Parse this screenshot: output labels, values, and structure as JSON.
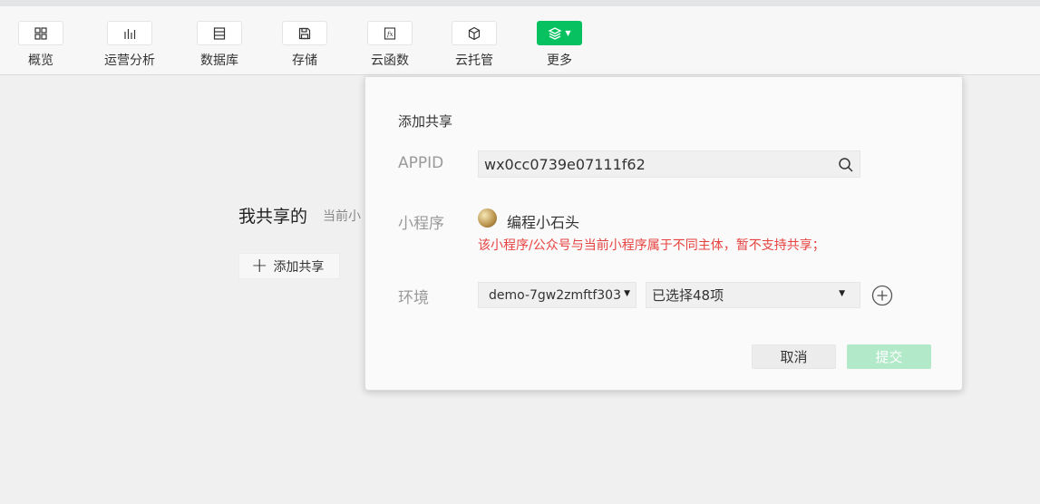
{
  "toolbar": {
    "items": [
      {
        "label": "概览",
        "icon": "grid-icon"
      },
      {
        "label": "运营分析",
        "icon": "bar-chart-icon"
      },
      {
        "label": "数据库",
        "icon": "database-icon"
      },
      {
        "label": "存储",
        "icon": "save-icon"
      },
      {
        "label": "云函数",
        "icon": "function-icon"
      },
      {
        "label": "云托管",
        "icon": "cube-icon"
      },
      {
        "label": "更多",
        "icon": "layers-icon"
      }
    ],
    "accent": "#07c160"
  },
  "background": {
    "title": "我共享的",
    "subtitle": "当前小",
    "add_button": "添加共享"
  },
  "dialog": {
    "title": "添加共享",
    "appid_label": "APPID",
    "appid_value": "wx0cc0739e07111f62",
    "mp_label": "小程序",
    "mp_name": "编程小石头",
    "mp_error": "该小程序/公众号与当前小程序属于不同主体，暂不支持共享；",
    "env_label": "环境",
    "env_value": "demo-7gw2zmftf303",
    "multi_value": "已选择48项",
    "cancel": "取消",
    "submit": "提交",
    "error_color": "#e64340"
  }
}
